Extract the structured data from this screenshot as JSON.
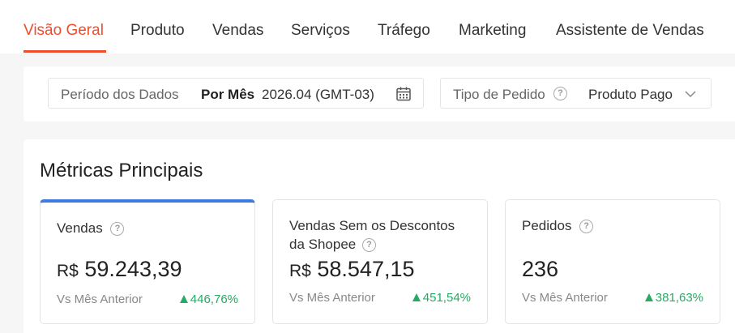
{
  "tabs": [
    {
      "label": "Visão Geral",
      "active": true
    },
    {
      "label": "Produto"
    },
    {
      "label": "Vendas"
    },
    {
      "label": "Serviços"
    },
    {
      "label": "Tráfego"
    },
    {
      "label": "Marketing"
    },
    {
      "label": "Assistente de Vendas"
    }
  ],
  "filters": {
    "period_label": "Período dos Dados",
    "period_mode": "Por Mês",
    "period_value": "2026.04 (GMT-03)",
    "period_icon": "calendar-icon",
    "order_type_label": "Tipo de Pedido",
    "order_type_value": "Produto Pago",
    "order_type_icon": "chevron-down-icon"
  },
  "metrics": {
    "title": "Métricas Principais",
    "cards": [
      {
        "title": "Vendas",
        "currency": "R$",
        "value": "59.243,39",
        "vs_label": "Vs Mês Anterior",
        "change": "446,76%",
        "trend": "up"
      },
      {
        "title": "Vendas Sem os Descontos da Shopee",
        "currency": "R$",
        "value": "58.547,15",
        "vs_label": "Vs Mês Anterior",
        "change": "451,54%",
        "trend": "up"
      },
      {
        "title": "Pedidos",
        "currency": "",
        "value": "236",
        "vs_label": "Vs Mês Anterior",
        "change": "381,63%",
        "trend": "up"
      }
    ]
  },
  "colors": {
    "accent": "#ee4d2d",
    "selected_card": "#3d7be0",
    "positive": "#26aa64"
  }
}
